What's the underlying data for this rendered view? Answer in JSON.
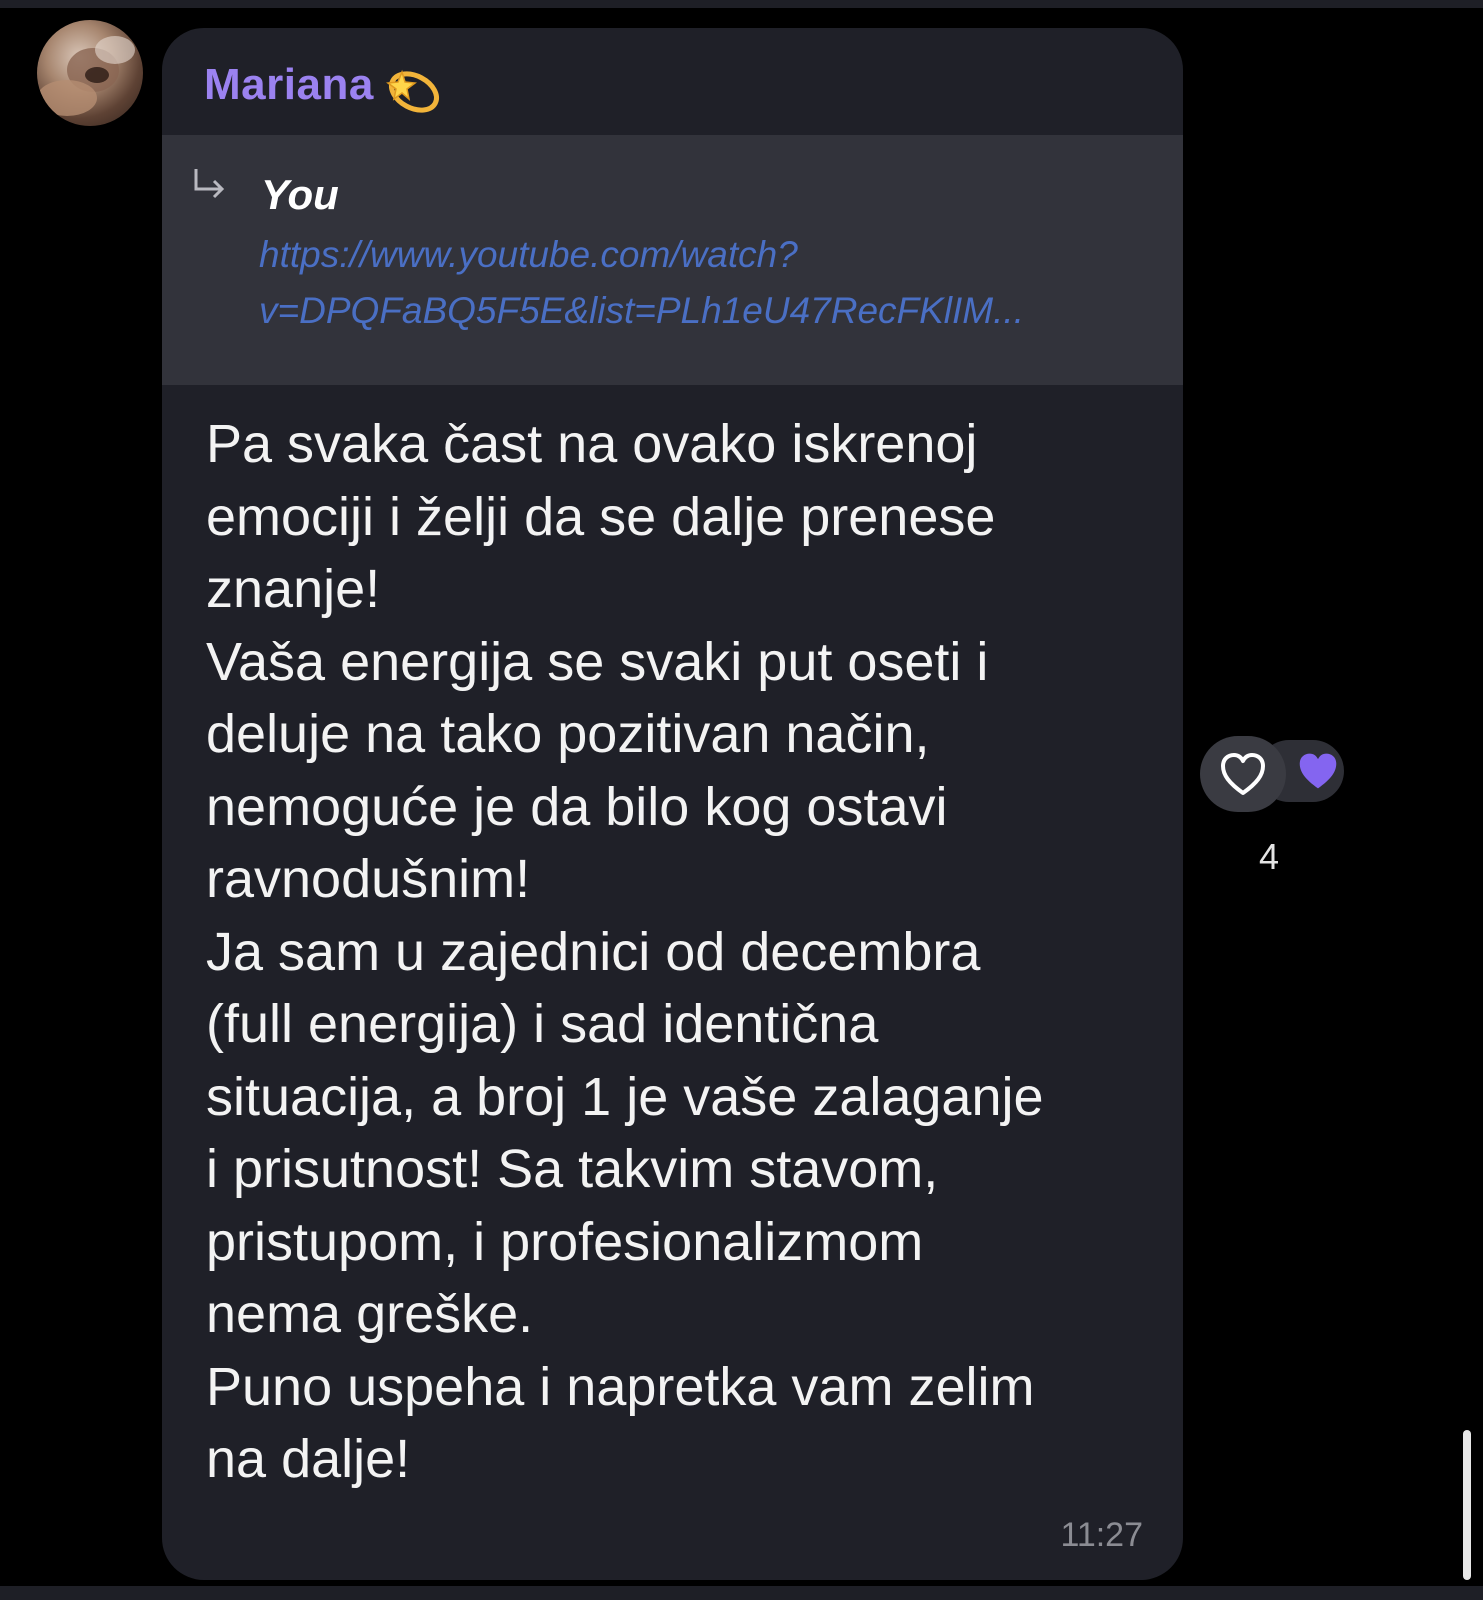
{
  "message": {
    "sender": "Mariana",
    "sender_emoji": "dizzy-sparkle-icon",
    "reply": {
      "author": "You",
      "link_lines": [
        "https://www.youtube.com/watch?",
        "v=DPQFaBQ5F5E&list=PLh1eU47RecFKlIM..."
      ]
    },
    "lines": [
      "Pa svaka čast na ovako iskrenoj",
      "emociji i želji da se dalje prenese",
      "znanje!",
      "Vaša energija se svaki put oseti i",
      "deluje na tako pozitivan način,",
      "nemoguće je da bilo kog ostavi",
      "ravnodušnim!",
      "Ja sam u zajednici od decembra",
      "(full energija) i sad identična",
      "situacija, a broj 1 je vaše zalaganje",
      "i prisutnost! Sa takvim stavom,",
      "pristupom, i profesionalizmom",
      "nema greške.",
      "Puno uspeha i napretka vam zelim",
      "na dalje!"
    ],
    "time": "11:27"
  },
  "reactions": {
    "icons": [
      "heart-outline-icon",
      "purple-heart-icon"
    ],
    "count": "4"
  },
  "colors": {
    "background": "#000000",
    "bubble": "#1f2028",
    "reply_bg": "#32333b",
    "sender_name": "#9b82f0",
    "link": "#4a6fc4",
    "purple_heart": "#8465f0"
  }
}
